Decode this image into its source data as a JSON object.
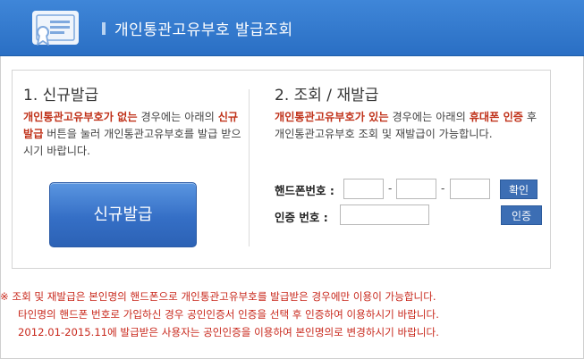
{
  "header": {
    "title": "개인통관고유부호 발급조회"
  },
  "new_issue": {
    "title": "1. 신규발급",
    "desc_hl": "개인통관고유부호가 없는",
    "desc_1": " 경우에는 아래의 ",
    "desc_btn": "신규발급",
    "desc_2": " 버튼을 눌러 개인통관고유부호를 발급 받으시기 바랍니다.",
    "button_label": "신규발급"
  },
  "lookup": {
    "title": "2. 조회 / 재발급",
    "desc_hl1": "개인통관고유부호가 있는",
    "desc_1": " 경우에는 아래의 ",
    "desc_hl2": "휴대폰 인증",
    "desc_2": " 후 개인통관고유부호 조회 및 재발급이 가능합니다.",
    "phone_label": "핸드폰번호 :",
    "phone_dash": "-",
    "confirm_button": "확인",
    "auth_label": "인증  번호 :",
    "auth_button": "인증",
    "phone_part1": "",
    "phone_part2": "",
    "phone_part3": "",
    "auth_value": ""
  },
  "notice": {
    "line1": "※ 조회 및 재발급은 본인명의 핸드폰으로 개인통관고유부호를 발급받은 경우에만 이용이 가능합니다.",
    "line2": "타인명의 핸드폰 번호로 가입하신 경우 공인인증서 인증을 선택 후 인증하여 이용하시기 바랍니다.",
    "line3": "2012.01-2015.11에 발급받은 사용자는 공인인증을 이용하여 본인명의로 변경하시기 바랍니다."
  },
  "colors": {
    "header_blue": "#2a6fc4",
    "button_blue": "#356fc6",
    "highlight_red": "#c0321a",
    "notice_red": "#c8281c"
  },
  "icons": {
    "header": "certificate-icon"
  }
}
